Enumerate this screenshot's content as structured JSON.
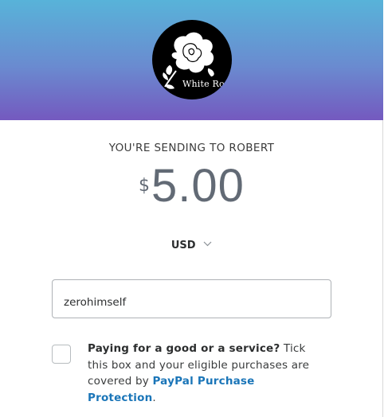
{
  "header": {
    "avatar_text": "White Ros"
  },
  "recipient": {
    "label": "YOU'RE SENDING TO ROBERT"
  },
  "amount": {
    "symbol": "$",
    "value": "5.00"
  },
  "currency": {
    "selected": "USD"
  },
  "note": {
    "value": "zerohimself"
  },
  "purchase_protection": {
    "question": "Paying for a good or a service?",
    "body": " Tick this box and your eligible purchases are covered by ",
    "link": "PayPal Purchase Protection",
    "suffix": ".",
    "checked": false
  }
}
